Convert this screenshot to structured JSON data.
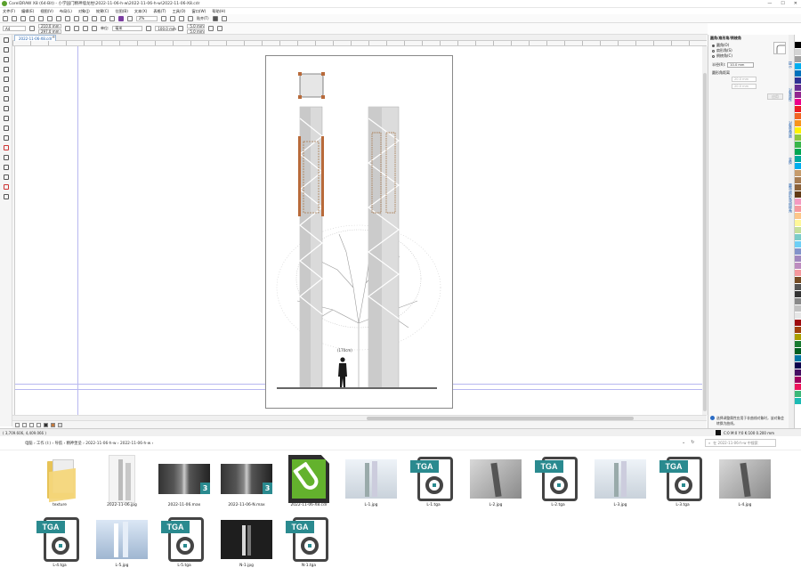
{
  "window": {
    "title": "CorelDRAW X8 (64-Bit) - 小学园门精神墙龙柱\\2022-11-06-h-w\\2022-11-06-h-w\\2022-11-06-X8.cdr",
    "controls": [
      "—",
      "☐",
      "✕"
    ]
  },
  "menu": [
    "文件(F)",
    "编辑(E)",
    "视图(V)",
    "布局(L)",
    "对象(J)",
    "效果(C)",
    "位图(B)",
    "文本(X)",
    "表格(T)",
    "工具(O)",
    "窗口(W)",
    "帮助(H)"
  ],
  "toolbar": {
    "zoom": "2%",
    "snap_label": "贴齐(T)",
    "units_label": "单位:",
    "units_value": "毫米",
    "page_size": "A4",
    "width": "210.0 mm",
    "height": "297.0 mm",
    "nudge": "100.0 mm",
    "dup_x": "5.0 mm",
    "dup_y": "5.0 mm"
  },
  "document_tab": "2022-11-06-X8.cdr",
  "ruler_tick": "500",
  "status": {
    "coords": "( 3,709.606, 4,409.066 )",
    "fill_info": "C:0 M:0 Y:0 K:100  0.200 mm",
    "none_label": "无"
  },
  "docker": {
    "title": "圆角/扇形角/倒棱角",
    "options": [
      "圆角(O)",
      "扇形角(S)",
      "倒棱角(C)"
    ],
    "radius_label": "半径(R):",
    "radius_value": "10.0 mm",
    "distance_label": "圆形角距离",
    "dist1": "20.0 mm",
    "dist2": "20.0 mm",
    "apply_label": "应用",
    "info_text": "选择调整属性应用于非曲线对象时，该对象会转换为曲线。"
  },
  "side_tabs": [
    "提示",
    "对象属性",
    "对象管理器",
    "变换",
    "圆角/扇形角/倒棱角"
  ],
  "palette": [
    "#ffffff",
    "#000000",
    "#d4d4d4",
    "#a0a0a0",
    "#00aeef",
    "#0072bc",
    "#2e3192",
    "#662d91",
    "#92278f",
    "#ec008c",
    "#ed1c24",
    "#f26522",
    "#f7941d",
    "#fff200",
    "#8dc63f",
    "#39b54a",
    "#00a651",
    "#00a99d",
    "#00aeef",
    "#c69c6d",
    "#a67c52",
    "#8c6239",
    "#603913",
    "#f49ac1",
    "#f6989d",
    "#fdc689",
    "#fff799",
    "#c4df9b",
    "#7accc8",
    "#6dcff6",
    "#8393ca",
    "#a187be",
    "#bd8cbf",
    "#f5989d",
    "#754c24",
    "#555555",
    "#333333",
    "#898989",
    "#c2c2c2",
    "#e6e6e6",
    "#9e0b0f",
    "#a0410d",
    "#aba000",
    "#197b30",
    "#005e20",
    "#0076a3",
    "#0d004c",
    "#440e62",
    "#9e005d",
    "#ed145b",
    "#3cb878",
    "#1cbbb4"
  ],
  "explorer": {
    "breadcrumb": [
      "电脑",
      "工作 (I:)",
      "导航",
      "精神堡垒",
      "2022-11-06-h-w",
      "2022-11-06-h-w"
    ],
    "search_placeholder": "在 2022-11-06-h-w 中搜索",
    "files": [
      {
        "name": "texture",
        "kind": "folder"
      },
      {
        "name": "2022-11-06.jpg",
        "kind": "photo-white"
      },
      {
        "name": "2022-11-06.max",
        "kind": "max"
      },
      {
        "name": "2022-11-06-N.max",
        "kind": "max"
      },
      {
        "name": "2022-11-06-X8.cdr",
        "kind": "cdr"
      },
      {
        "name": "L-1.jpg",
        "kind": "photo-light"
      },
      {
        "name": "L-1.tga",
        "kind": "tga"
      },
      {
        "name": "L-2.jpg",
        "kind": "photo-gray"
      },
      {
        "name": "L-2.tga",
        "kind": "tga"
      },
      {
        "name": "L-3.jpg",
        "kind": "photo-light"
      },
      {
        "name": "L-3.tga",
        "kind": "tga"
      },
      {
        "name": "L-4.jpg",
        "kind": "photo-gray"
      },
      {
        "name": "L-4.tga",
        "kind": "tga"
      },
      {
        "name": "L-5.jpg",
        "kind": "photo-blue"
      },
      {
        "name": "L-5.tga",
        "kind": "tga"
      },
      {
        "name": "N-1.jpg",
        "kind": "photo-dark"
      },
      {
        "name": "N-1.tga",
        "kind": "tga"
      }
    ]
  },
  "drawing": {
    "height_label": "(170cm)"
  }
}
